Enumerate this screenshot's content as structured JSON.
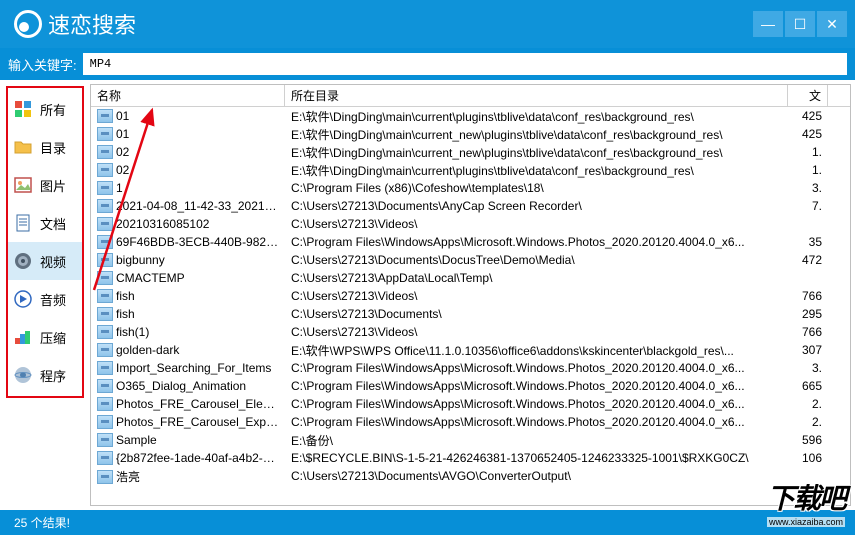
{
  "app": {
    "title": "速恋搜索"
  },
  "search": {
    "label": "输入关键字:",
    "value": "MP4"
  },
  "sidebar": {
    "items": [
      {
        "id": "all",
        "label": "所有"
      },
      {
        "id": "dir",
        "label": "目录"
      },
      {
        "id": "image",
        "label": "图片"
      },
      {
        "id": "doc",
        "label": "文档"
      },
      {
        "id": "video",
        "label": "视频"
      },
      {
        "id": "audio",
        "label": "音频"
      },
      {
        "id": "archive",
        "label": "压缩"
      },
      {
        "id": "program",
        "label": "程序"
      }
    ],
    "selected": "video"
  },
  "columns": {
    "name": "名称",
    "dir": "所在目录",
    "size": "文"
  },
  "files": [
    {
      "name": "01",
      "dir": "E:\\软件\\DingDing\\main\\current\\plugins\\tblive\\data\\conf_res\\background_res\\",
      "size": "425"
    },
    {
      "name": "01",
      "dir": "E:\\软件\\DingDing\\main\\current_new\\plugins\\tblive\\data\\conf_res\\background_res\\",
      "size": "425"
    },
    {
      "name": "02",
      "dir": "E:\\软件\\DingDing\\main\\current_new\\plugins\\tblive\\data\\conf_res\\background_res\\",
      "size": "1."
    },
    {
      "name": "02",
      "dir": "E:\\软件\\DingDing\\main\\current\\plugins\\tblive\\data\\conf_res\\background_res\\",
      "size": "1."
    },
    {
      "name": "1",
      "dir": "C:\\Program Files (x86)\\Cofeshow\\templates\\18\\",
      "size": "3."
    },
    {
      "name": "2021-04-08_11-42-33_2021-0...",
      "dir": "C:\\Users\\27213\\Documents\\AnyCap Screen Recorder\\",
      "size": "7."
    },
    {
      "name": "20210316085102",
      "dir": "C:\\Users\\27213\\Videos\\",
      "size": ""
    },
    {
      "name": "69F46BDB-3ECB-440B-9821-...",
      "dir": "C:\\Program Files\\WindowsApps\\Microsoft.Windows.Photos_2020.20120.4004.0_x6...",
      "size": "35"
    },
    {
      "name": "bigbunny",
      "dir": "C:\\Users\\27213\\Documents\\DocusTree\\Demo\\Media\\",
      "size": "472"
    },
    {
      "name": "CMACTEMP",
      "dir": "C:\\Users\\27213\\AppData\\Local\\Temp\\",
      "size": ""
    },
    {
      "name": "fish",
      "dir": "C:\\Users\\27213\\Videos\\",
      "size": "766"
    },
    {
      "name": "fish",
      "dir": "C:\\Users\\27213\\Documents\\",
      "size": "295"
    },
    {
      "name": "fish(1)",
      "dir": "C:\\Users\\27213\\Videos\\",
      "size": "766"
    },
    {
      "name": "golden-dark",
      "dir": "E:\\软件\\WPS\\WPS Office\\11.1.0.10356\\office6\\addons\\kskincenter\\blackgold_res\\...",
      "size": "307"
    },
    {
      "name": "Import_Searching_For_Items",
      "dir": "C:\\Program Files\\WindowsApps\\Microsoft.Windows.Photos_2020.20120.4004.0_x6...",
      "size": "3."
    },
    {
      "name": "O365_Dialog_Animation",
      "dir": "C:\\Program Files\\WindowsApps\\Microsoft.Windows.Photos_2020.20120.4004.0_x6...",
      "size": "665"
    },
    {
      "name": "Photos_FRE_Carousel_Elevato...",
      "dir": "C:\\Program Files\\WindowsApps\\Microsoft.Windows.Photos_2020.20120.4004.0_x6...",
      "size": "2."
    },
    {
      "name": "Photos_FRE_Carousel_Explor...",
      "dir": "C:\\Program Files\\WindowsApps\\Microsoft.Windows.Photos_2020.20120.4004.0_x6...",
      "size": "2."
    },
    {
      "name": "Sample",
      "dir": "E:\\备份\\",
      "size": "596"
    },
    {
      "name": "{2b872fee-1ade-40af-a4b2-9...",
      "dir": "E:\\$RECYCLE.BIN\\S-1-5-21-426246381-1370652405-1246233325-1001\\$RXKG0CZ\\",
      "size": "106"
    },
    {
      "name": "浩亮",
      "dir": "C:\\Users\\27213\\Documents\\AVGO\\ConverterOutput\\",
      "size": ""
    }
  ],
  "footer": {
    "count": "25 个结果!"
  },
  "watermark": {
    "text": "下载吧",
    "url": "www.xiazaiba.com"
  }
}
